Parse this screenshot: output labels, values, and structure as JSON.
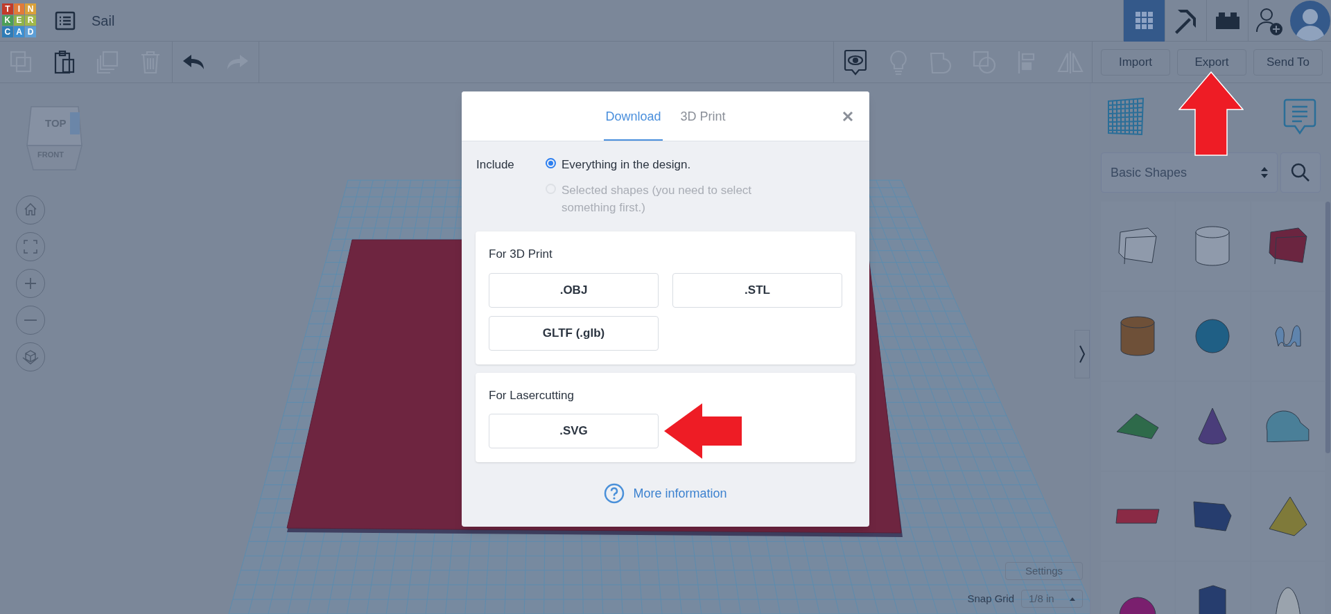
{
  "app_bar": {
    "logo_letters": [
      "T",
      "I",
      "N",
      "K",
      "E",
      "R",
      "C",
      "A",
      "D"
    ],
    "design_name": "Sail",
    "view_buttons": [
      {
        "kind": "grid",
        "selected": true
      },
      {
        "kind": "pickaxe",
        "selected": false
      },
      {
        "kind": "bricks",
        "selected": false
      }
    ]
  },
  "toolbar": {
    "edit_tools": [
      {
        "kind": "copy",
        "disabled": true
      },
      {
        "kind": "paste",
        "disabled": false
      },
      {
        "kind": "duplicate",
        "disabled": true
      },
      {
        "kind": "delete",
        "disabled": true
      },
      {
        "kind": "undo",
        "disabled": false
      },
      {
        "kind": "redo",
        "disabled": true
      }
    ],
    "view_tools": [
      {
        "kind": "notes",
        "disabled": false
      },
      {
        "kind": "bulb",
        "disabled": true
      },
      {
        "kind": "group",
        "disabled": true
      },
      {
        "kind": "ungroup",
        "disabled": true
      },
      {
        "kind": "align",
        "disabled": true
      },
      {
        "kind": "mirror",
        "disabled": true
      }
    ],
    "actions": [
      "Import",
      "Export",
      "Send To"
    ]
  },
  "viewcube": {
    "top": "TOP",
    "front": "FRONT"
  },
  "canvas": {
    "settings": "Settings",
    "snap_grid_label": "Snap Grid",
    "snap_grid_value": "1/8 in"
  },
  "shapes_panel": {
    "category": "Basic Shapes",
    "shapes": [
      {
        "kind": "box-hole",
        "color": "#8f9aab"
      },
      {
        "kind": "cylinder-hole",
        "color": "#8f9aab"
      },
      {
        "kind": "box",
        "color": "#6b2540"
      },
      {
        "kind": "cylinder",
        "color": "#6e5038"
      },
      {
        "kind": "sphere",
        "color": "#1f5f85"
      },
      {
        "kind": "scribble",
        "color": "#5f84ad"
      },
      {
        "kind": "roof",
        "color": "#2e6a4a"
      },
      {
        "kind": "cone",
        "color": "#4a3d7a"
      },
      {
        "kind": "round-roof",
        "color": "#4a7f98"
      },
      {
        "kind": "text",
        "color": "#8a2a45"
      },
      {
        "kind": "wedge",
        "color": "#263d6e"
      },
      {
        "kind": "pyramid",
        "color": "#7f7a3a"
      },
      {
        "kind": "half-sphere",
        "color": "#7a1f6e"
      },
      {
        "kind": "polygon",
        "color": "#263d6e"
      },
      {
        "kind": "paraboloid",
        "color": "#9aa3ad"
      }
    ]
  },
  "export_dialog": {
    "tabs": [
      {
        "label": "Download",
        "selected": true
      },
      {
        "label": "3D Print",
        "selected": false
      }
    ],
    "include_label": "Include",
    "include_options": [
      {
        "label": "Everything in the design.",
        "selected": true,
        "disabled": false
      },
      {
        "label": "Selected shapes (you need to select something first.)",
        "selected": false,
        "disabled": true
      }
    ],
    "sections": [
      {
        "title": "For 3D Print",
        "formats": [
          ".OBJ",
          ".STL",
          "GLTF (.glb)"
        ]
      },
      {
        "title": "For Lasercutting",
        "formats": [
          ".SVG"
        ]
      }
    ],
    "more_info": "More information"
  }
}
